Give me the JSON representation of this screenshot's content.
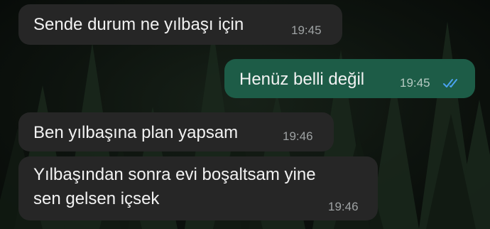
{
  "chat": {
    "messages": [
      {
        "direction": "incoming",
        "text": "Sende durum ne yılbaşı için",
        "time": "19:45"
      },
      {
        "direction": "outgoing",
        "text": "Henüz belli değil",
        "time": "19:45",
        "status_icon": "double-check-read-icon",
        "status_color": "#4aa3f0"
      },
      {
        "direction": "incoming",
        "text": "Ben yılbaşına plan yapsam",
        "time": "19:46"
      },
      {
        "direction": "incoming",
        "lines": [
          "Yılbaşından sonra evi boşaltsam yine",
          "sen gelsen içsek"
        ],
        "time": "19:46"
      }
    ]
  },
  "theme": {
    "incoming_bubble": "#262626",
    "outgoing_bubble": "#1d5c47",
    "background": "#0d130e"
  }
}
